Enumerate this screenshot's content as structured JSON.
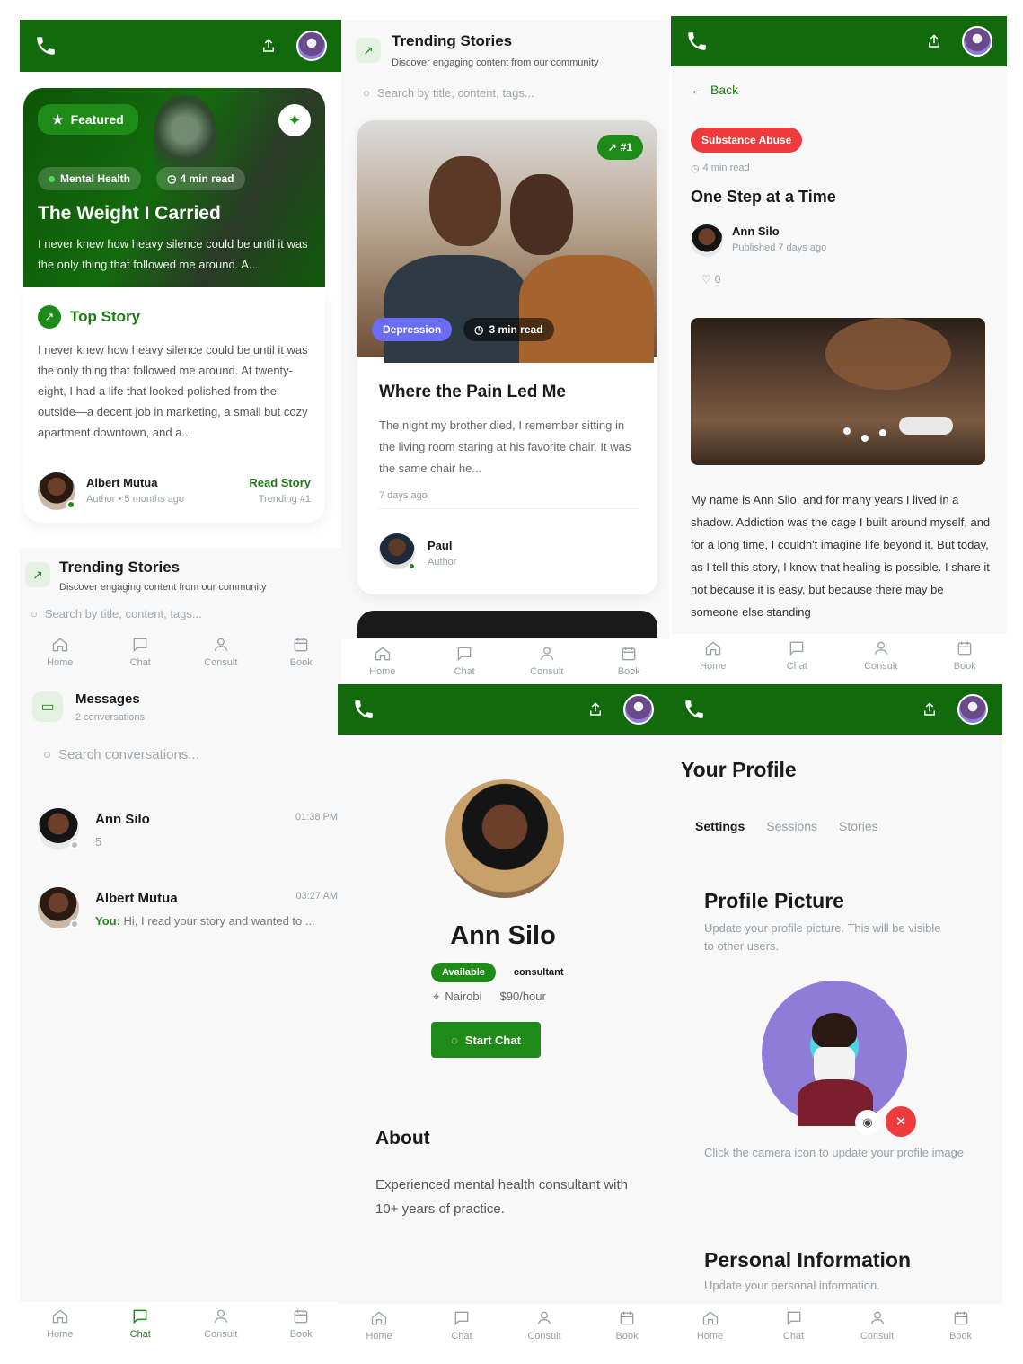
{
  "nav": {
    "home": "Home",
    "chat": "Chat",
    "consult": "Consult",
    "book": "Book"
  },
  "p1": {
    "featured": "Featured",
    "tag": "Mental Health",
    "read_time": "4 min read",
    "title": "The Weight I Carried",
    "excerpt": "I never knew how heavy silence could be until it was the only thing that followed me around. A...",
    "top_story": "Top Story",
    "body": "I never knew how heavy silence could be until it was the only thing that followed me around. At twenty-eight, I had a life that looked polished from the outside—a decent job in marketing, a small but cozy apartment downtown, and a...",
    "author": "Albert Mutua",
    "author_role": "Author",
    "time_ago": "5 months ago",
    "read_story": "Read Story",
    "trending_rank": "Trending #1"
  },
  "trending": {
    "title": "Trending Stories",
    "subtitle": "Discover engaging content from our community",
    "search_placeholder": "Search by title, content, tags..."
  },
  "p2": {
    "rank": "#1",
    "tag": "Depression",
    "read_time": "3 min read",
    "title": "Where the Pain Led Me",
    "excerpt": "The night my brother died, I remember sitting in the living room staring at his favorite chair. It was the same chair he...",
    "time_ago": "7 days ago",
    "author": "Paul",
    "author_role": "Author"
  },
  "p3": {
    "back": "Back",
    "tag": "Substance Abuse",
    "read_time": "4 min read",
    "title": "One Step at a Time",
    "author": "Ann Silo",
    "published": "Published 7 days ago",
    "likes": "0",
    "body": "My name is Ann Silo, and for many years I lived in a shadow. Addiction was the cage I built around myself, and for a long time, I couldn't imagine life beyond it. But today, as I tell this story, I know that healing is possible. I share it not because it is easy, but because there may be someone else standing"
  },
  "messages": {
    "title": "Messages",
    "count": "2 conversations",
    "search_placeholder": "Search conversations...",
    "items": [
      {
        "name": "Ann Silo",
        "time": "01:38 PM",
        "preview": "5",
        "you": ""
      },
      {
        "name": "Albert Mutua",
        "time": "03:27 AM",
        "preview": "Hi, I read your story and wanted to ...",
        "you": "You:"
      }
    ]
  },
  "consultant": {
    "name": "Ann Silo",
    "status": "Available",
    "role": "consultant",
    "location": "Nairobi",
    "rate": "$90/hour",
    "start_chat": "Start Chat",
    "about_title": "About",
    "about": "Experienced mental health consultant with 10+ years of practice."
  },
  "profile": {
    "title": "Your Profile",
    "tabs": [
      "Settings",
      "Sessions",
      "Stories"
    ],
    "pic_title": "Profile Picture",
    "pic_desc": "Update your profile picture. This will be visible to other users.",
    "pic_hint": "Click the camera icon to update your profile image",
    "info_title": "Personal Information",
    "info_desc": "Update your personal information."
  },
  "colors": {
    "brand": "#136a0d",
    "accent_green": "#1e7a17",
    "depression": "#6b6cf5",
    "substance": "#ef3b3b"
  }
}
